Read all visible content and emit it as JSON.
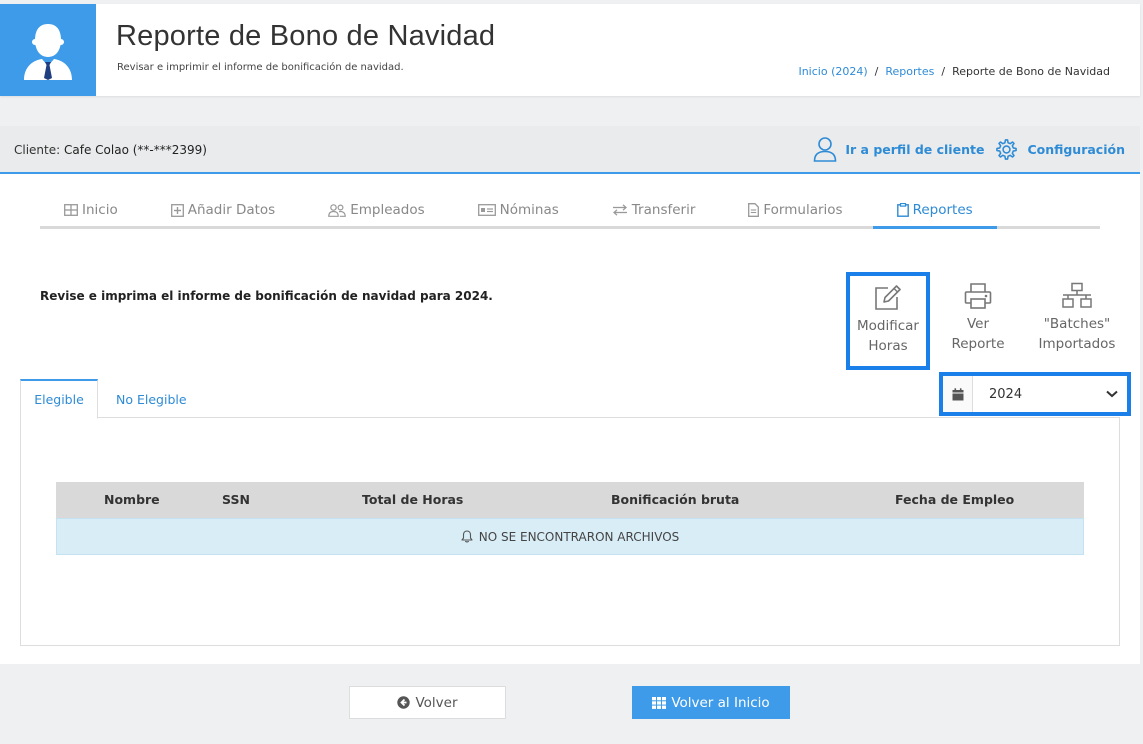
{
  "header": {
    "title": "Reporte de Bono de Navidad",
    "subtitle": "Revisar e imprimir el informe de bonificación de navidad.",
    "breadcrumb": [
      {
        "label": "Inicio (2024)"
      },
      {
        "sep": "/"
      },
      {
        "label": "Reportes"
      },
      {
        "sep": "/"
      },
      {
        "label": "Reporte de Bono de Navidad"
      }
    ]
  },
  "client": {
    "prefix": "Cliente:",
    "name": "Cafe Colao (**-***2399)",
    "profile_link": "Ir a perfil de cliente",
    "settings_link": "Configuración"
  },
  "nav": {
    "tabs": [
      {
        "label": "Inicio",
        "icon": "grid-icon"
      },
      {
        "label": "Añadir Datos",
        "icon": "plus-square-icon"
      },
      {
        "label": "Empleados",
        "icon": "users-icon"
      },
      {
        "label": "Nóminas",
        "icon": "id-card-icon"
      },
      {
        "label": "Transferir",
        "icon": "exchange-icon"
      },
      {
        "label": "Formularios",
        "icon": "document-icon"
      },
      {
        "label": "Reportes",
        "icon": "clipboard-icon"
      }
    ],
    "active": "Reportes"
  },
  "intro": "Revise e imprima el informe de bonificación de navidad para 2024.",
  "tools": {
    "edit_hours": {
      "line1": "Modificar",
      "line2": "Horas"
    },
    "view_report": {
      "line1": "Ver",
      "line2": "Reporte"
    },
    "batches": {
      "line1": "\"Batches\"",
      "line2": "Importados"
    }
  },
  "subtabs": {
    "eligible": "Elegible",
    "not_eligible": "No Elegible"
  },
  "year_select": {
    "value": "2024"
  },
  "table": {
    "columns": [
      "Nombre",
      "SSN",
      "Total de Horas",
      "Bonificación bruta",
      "Fecha de Empleo"
    ],
    "empty_message": "NO SE ENCONTRARON ARCHIVOS"
  },
  "footer": {
    "back": "Volver",
    "home": "Volver al Inicio"
  },
  "colors": {
    "accent": "#3d9be9",
    "highlight": "#1a7fe8"
  }
}
